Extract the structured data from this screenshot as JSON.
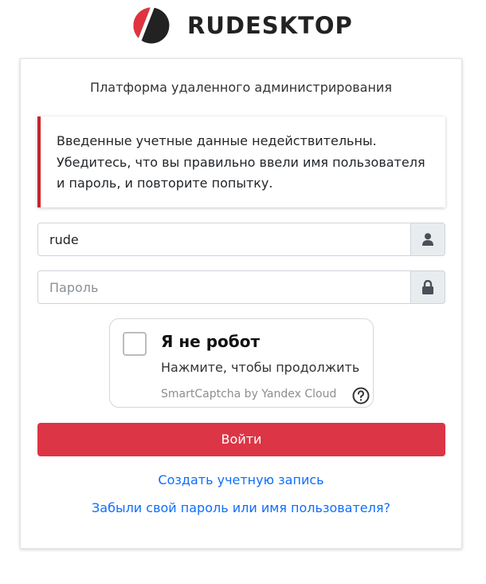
{
  "brand": {
    "logo_icon": "rudesktop-logo-icon",
    "name": "RUDESKTOP",
    "colors": {
      "red": "#e0343f",
      "dark": "#222222"
    }
  },
  "login": {
    "subtitle": "Платформа удаленного администрирования",
    "error_message": "Введенные учетные данные недействительны. Убедитесь, что вы правильно ввели имя пользователя и пароль, и повторите попытку.",
    "username": {
      "value": "rude",
      "placeholder": "",
      "icon": "user-icon"
    },
    "password": {
      "value": "",
      "placeholder": "Пароль",
      "icon": "lock-icon"
    },
    "captcha": {
      "title": "Я не робот",
      "hint": "Нажмите, чтобы продолжить",
      "brand": "SmartCaptcha by Yandex Cloud",
      "checked": false,
      "help_icon": "question-circle-icon"
    },
    "submit_label": "Войти",
    "register_link": "Создать учетную запись",
    "forgot_link": "Забыли свой пароль или имя пользователя?",
    "colors": {
      "accent": "#dc3545",
      "alert_border": "#c9232d",
      "link": "#0d6efd"
    }
  }
}
